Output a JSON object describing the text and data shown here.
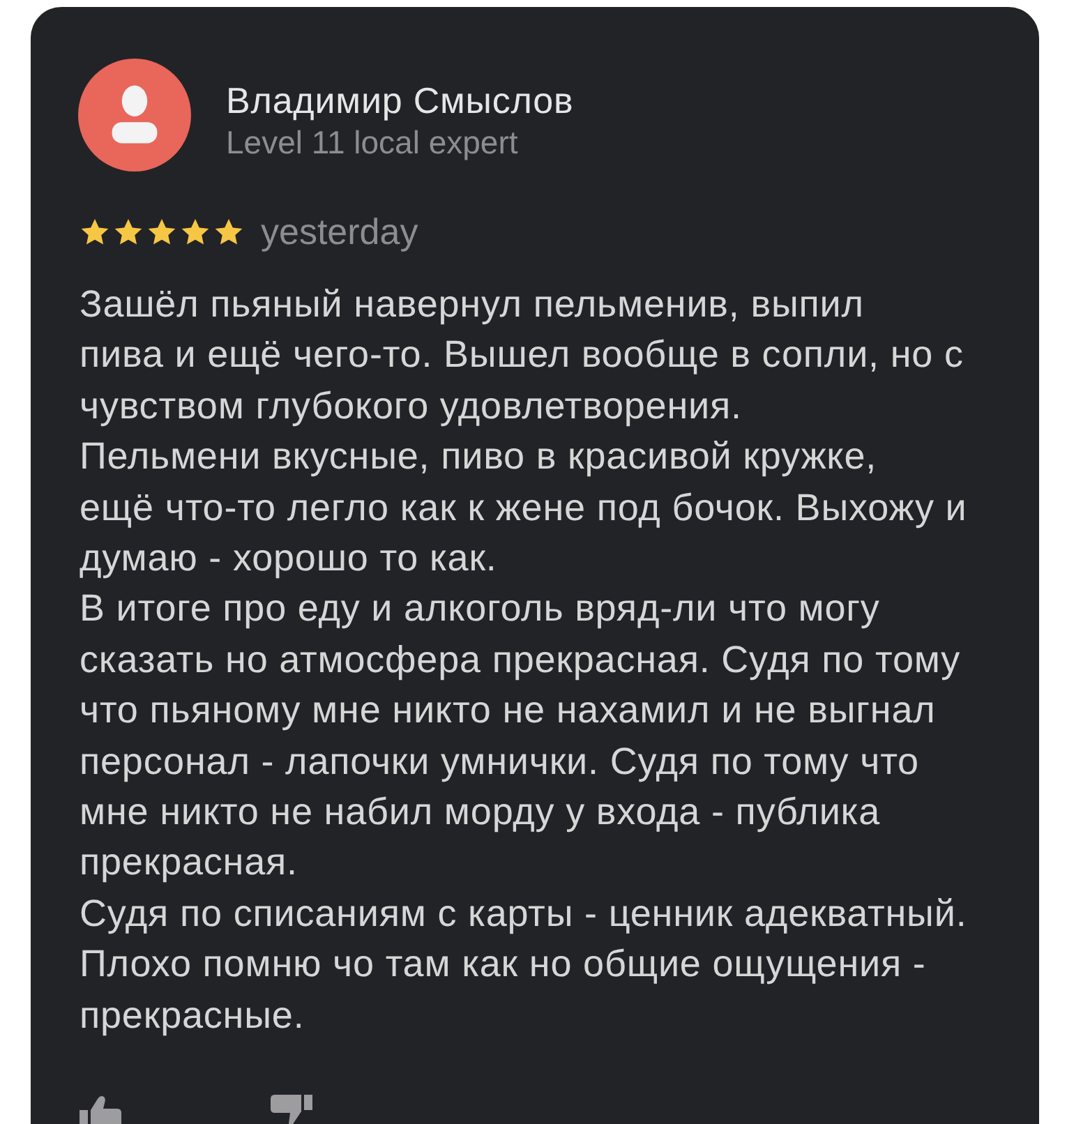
{
  "review": {
    "author": {
      "name": "Владимир Смыслов",
      "level": "Level 11 local expert"
    },
    "stars": 5,
    "date": "yesterday",
    "text": "Зашёл пьяный навернул пельменив, выпил\nпива и ещё чего-то. Вышел вообще в сопли, но с\nчувством глубокого удовлетворения.\nПельмени вкусные, пиво в красивой кружке,\nещё что-то легло как к жене под бочок. Выхожу и\nдумаю - хорошо то как.\nВ итоге про еду и алкоголь вряд-ли что могу\nсказать но атмосфера прекрасная. Судя по тому\nчто пьяному мне никто не нахамил и не выгнал\nперсонал - лапочки умнички. Судя по тому что\nмне никто не набил морду у входа - публика\nпрекрасная.\nСудя по списаниям с карты - ценник адекватный.\nПлохо помню чо там как но общие ощущения -\nпрекрасные."
  }
}
